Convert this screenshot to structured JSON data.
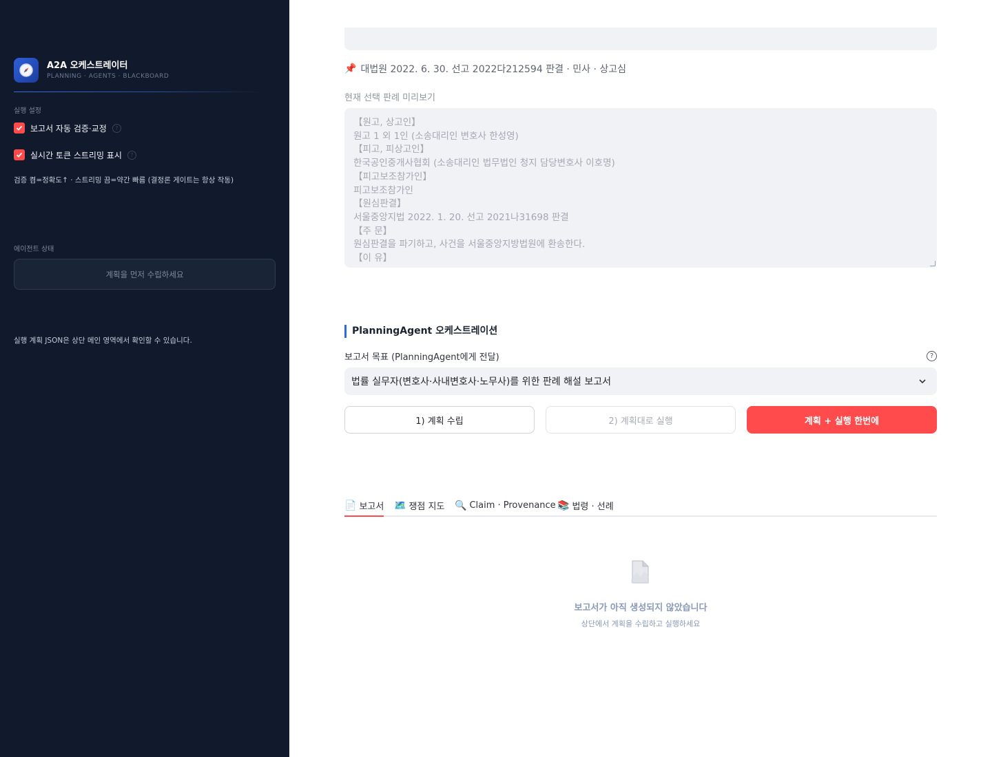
{
  "sidebar": {
    "brand_title": "A2A 오케스트레이터",
    "brand_subtitle": "PLANNING · AGENTS · BLACKBOARD",
    "settings_label": "실행 설정",
    "checkbox_verify": "보고서 자동 검증·교정",
    "checkbox_stream": "실시간 토큰 스트리밍 표시",
    "settings_note": "검증 켬=정확도↑ · 스트리밍 끔=약간 빠름 (결정론 게이트는 항상 작동)",
    "agent_status_label": "에이전트 상태",
    "agent_status_placeholder": "계획을 먼저 수립하세요",
    "json_note": "실행 계획 JSON은 상단 메인 영역에서 확인할 수 있습니다."
  },
  "main": {
    "case_line": "대법원 2022. 6. 30. 선고 2022다212594 판결 · 민사 · 상고심",
    "preview_label": "현재 선택 판례 미리보기",
    "preview_lines": [
      "【원고, 상고인】",
      "원고 1 외 1인 (소송대리인 변호사 한성영)",
      "【피고, 피상고인】",
      "한국공인중개사협회 (소송대리인 법무법인 청지 담당변호사 이호명)",
      "【피고보조참가인】",
      "피고보조참가인",
      "【원심판결】",
      "서울중앙지법 2022. 1. 20. 선고 2021나31698 판결",
      "【주 문】",
      "원심판결을 파기하고, 사건을 서울중앙지방법원에 환송한다.",
      "【이 유】"
    ],
    "section_title": "PlanningAgent 오케스트레이션",
    "goal_label": "보고서 목표 (PlanningAgent에게 전달)",
    "goal_value": "법률 실무자(변호사·사내변호사·노무사)를 위한 판례 해설 보고서",
    "buttons": {
      "plan": "1) 계획 수립",
      "run": "2) 계획대로 실행",
      "all": "계획 + 실행 한번에"
    },
    "tabs": [
      {
        "icon": "📄",
        "label": "보고서"
      },
      {
        "icon": "🗺️",
        "label": "쟁점 지도"
      },
      {
        "icon": "🔍",
        "label": "Claim · Provenance"
      },
      {
        "icon": "📚",
        "label": "법령 · 선례"
      }
    ],
    "empty_title": "보고서가 아직 생성되지 않았습니다",
    "empty_subtitle": "상단에서 계획을 수립하고 실행하세요"
  },
  "colors": {
    "sidebar_bg": "#111a2c",
    "accent_red": "#ff4b4b",
    "accent_blue": "#2f6bde"
  }
}
